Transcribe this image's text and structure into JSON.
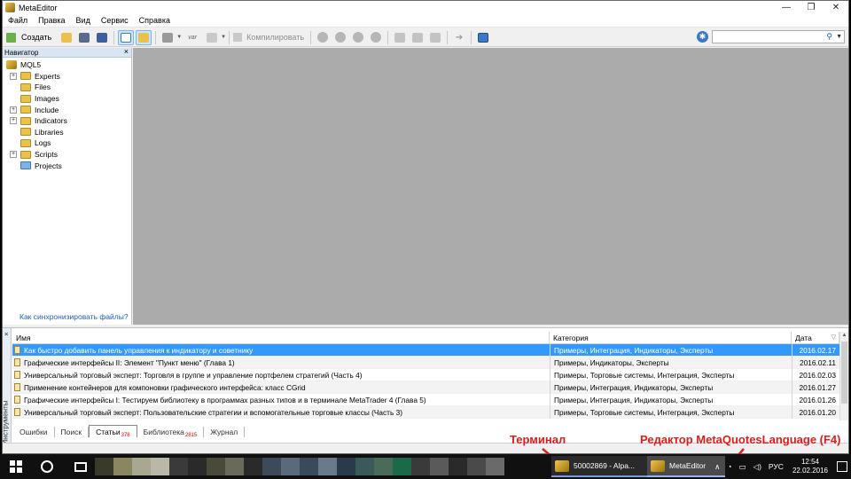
{
  "window": {
    "title": "MetaEditor",
    "controls": [
      "—",
      "❐",
      "✕"
    ]
  },
  "menu": [
    "Файл",
    "Правка",
    "Вид",
    "Сервис",
    "Справка"
  ],
  "toolbar": {
    "create_label": "Создать",
    "compile_label": "Компилировать",
    "search_placeholder": "",
    "var_label": "var"
  },
  "navigator": {
    "title": "Навигатор",
    "root": "MQL5",
    "items": [
      {
        "label": "Experts",
        "expandable": true
      },
      {
        "label": "Files",
        "expandable": false
      },
      {
        "label": "Images",
        "expandable": false
      },
      {
        "label": "Include",
        "expandable": true
      },
      {
        "label": "Indicators",
        "expandable": true
      },
      {
        "label": "Libraries",
        "expandable": false
      },
      {
        "label": "Logs",
        "expandable": false
      },
      {
        "label": "Scripts",
        "expandable": true
      },
      {
        "label": "Projects",
        "expandable": false
      }
    ],
    "sync_link": "Как синхронизировать файлы?"
  },
  "tools": {
    "side_label": "Инструменты",
    "columns": {
      "name": "Имя",
      "category": "Категория",
      "date": "Дата"
    },
    "rows": [
      {
        "name": "Как быстро добавить панель управления к индикатору и советнику",
        "category": "Примеры, Интеграция, Индикаторы, Эксперты",
        "date": "2016.02.17",
        "selected": true
      },
      {
        "name": "Графические интерфейсы II: Элемент \"Пункт меню\" (Глава 1)",
        "category": "Примеры, Индикаторы, Эксперты",
        "date": "2016.02.11"
      },
      {
        "name": "Универсальный торговый эксперт: Торговля в группе и управление портфелем стратегий (Часть 4)",
        "category": "Примеры, Торговые системы, Интеграция, Эксперты",
        "date": "2016.02.03"
      },
      {
        "name": "Применение контейнеров для компоновки графического интерфейса: класс CGrid",
        "category": "Примеры, Интеграция, Индикаторы, Эксперты",
        "date": "2016.01.27"
      },
      {
        "name": "Графические интерфейсы I: Тестируем библиотеку в программах разных типов и в терминале MetaTrader 4 (Глава 5)",
        "category": "Примеры, Интеграция, Индикаторы, Эксперты",
        "date": "2016.01.26"
      },
      {
        "name": "Универсальный торговый эксперт: Пользовательские стратегии и вспомогательные торговые классы (Часть 3)",
        "category": "Примеры, Торговые системы, Интеграция, Эксперты",
        "date": "2016.01.20"
      }
    ],
    "tabs": [
      {
        "label": "Ошибки",
        "count": ""
      },
      {
        "label": "Поиск",
        "count": ""
      },
      {
        "label": "Статьи",
        "count": "378",
        "active": true
      },
      {
        "label": "Библиотека",
        "count": "2815"
      },
      {
        "label": "Журнал",
        "count": ""
      }
    ]
  },
  "annotations": {
    "terminal": "Терминал",
    "editor": "Редактор MetaQuotesLanguage (F4)"
  },
  "taskbar": {
    "item1": "50002869 - Alpa...",
    "item2": "MetaEditor",
    "lang": "РУС",
    "time": "12:54",
    "date": "22.02.2016"
  },
  "colors": {
    "selection": "#3399ff",
    "annotation": "#e31a1a",
    "workspace": "#ababab"
  }
}
